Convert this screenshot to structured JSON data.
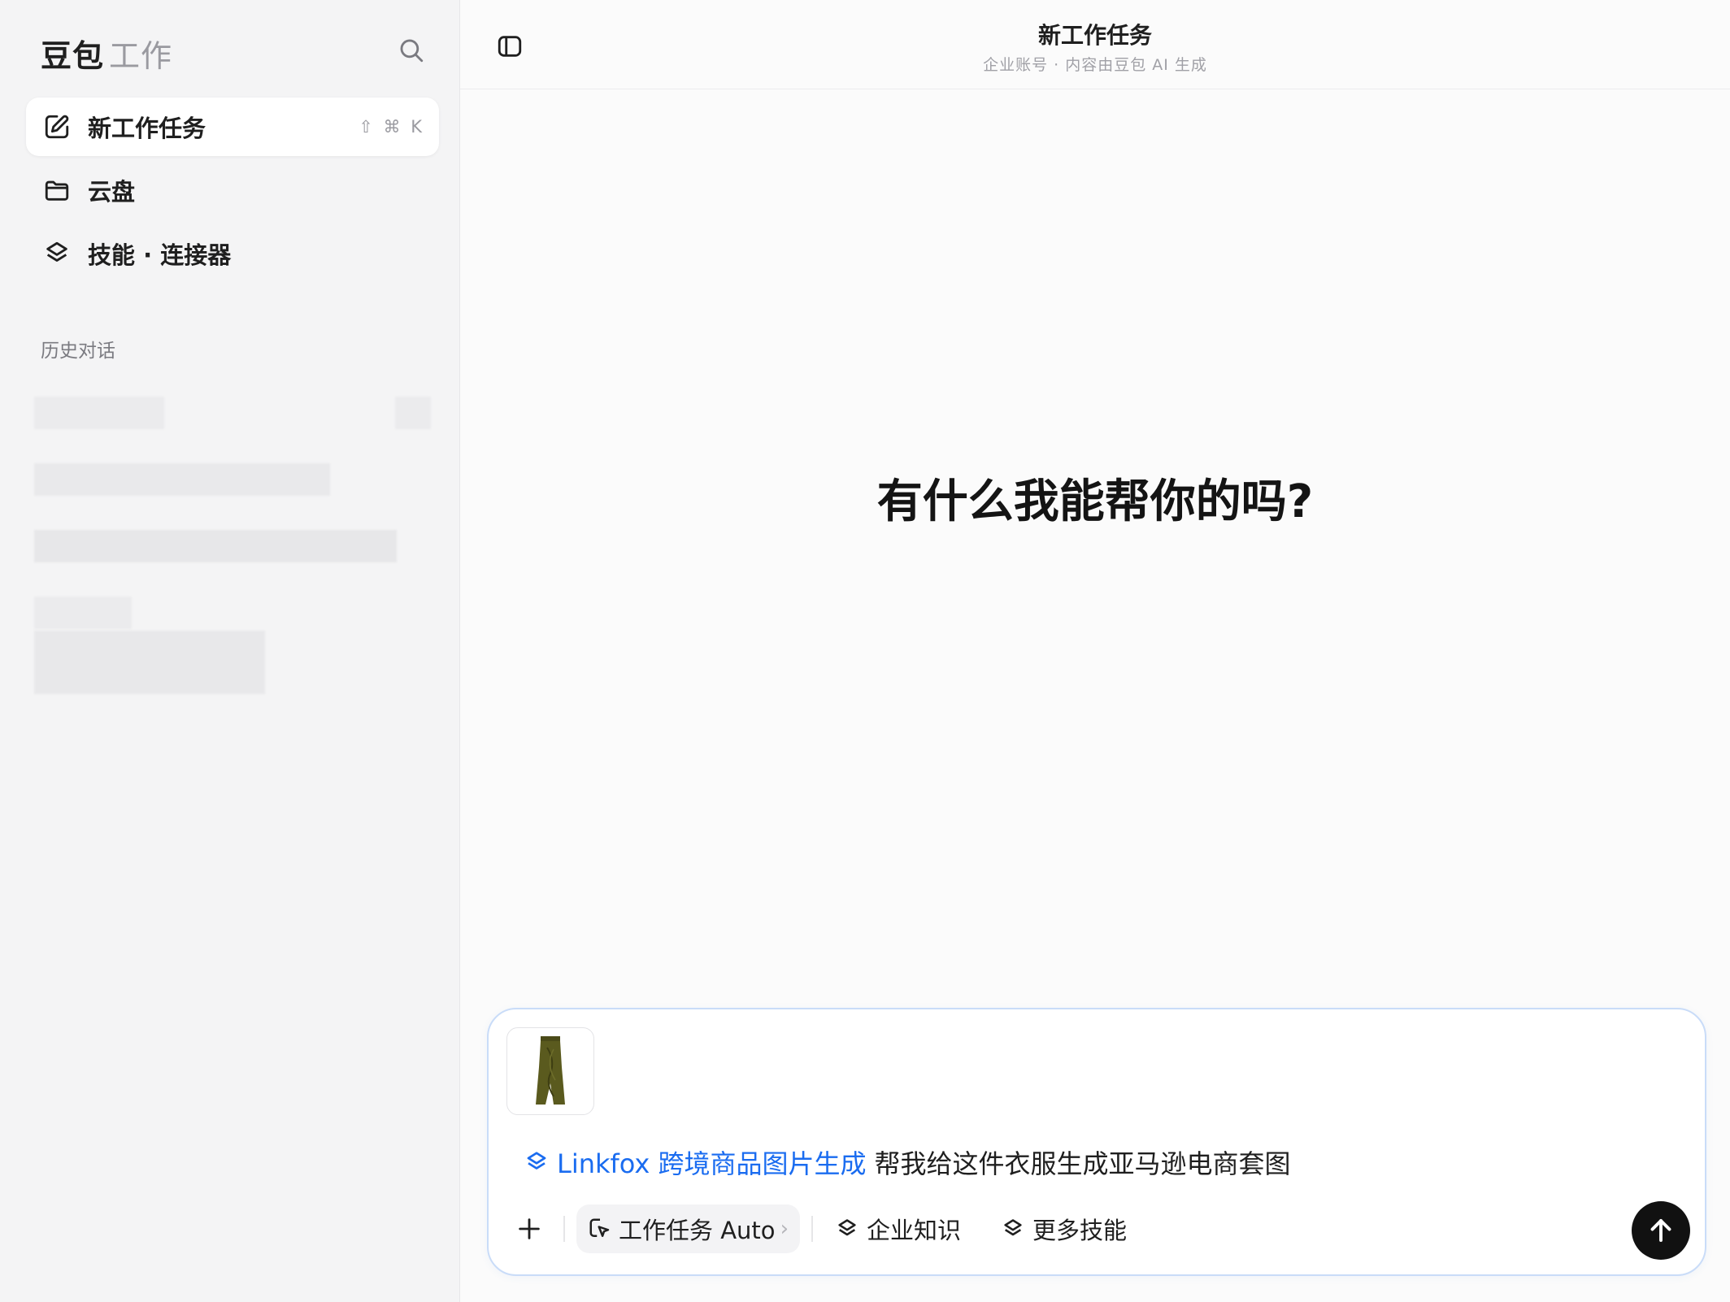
{
  "sidebar": {
    "brand_primary": "豆包",
    "brand_secondary": "工作",
    "nav": [
      {
        "label": "新工作任务",
        "shortcut": "⇧ ⌘ K"
      },
      {
        "label": "云盘"
      },
      {
        "label": "技能 · 连接器"
      }
    ],
    "history_label": "历史对话"
  },
  "header": {
    "title": "新工作任务",
    "subtitle": "企业账号 · 内容由豆包 AI 生成"
  },
  "main": {
    "hero": "有什么我能帮你的吗?"
  },
  "composer": {
    "skill_label": "Linkfox 跨境商品图片生成",
    "prompt_text": "帮我给这件衣服生成亚马逊电商套图",
    "mode_label": "工作任务 Auto",
    "mode_chevron": "›",
    "chip_knowledge": "企业知识",
    "chip_more_skills": "更多技能"
  },
  "colors": {
    "accent": "#1a6cf0",
    "composer_border": "#c9dcf8",
    "send_button": "#111111"
  }
}
